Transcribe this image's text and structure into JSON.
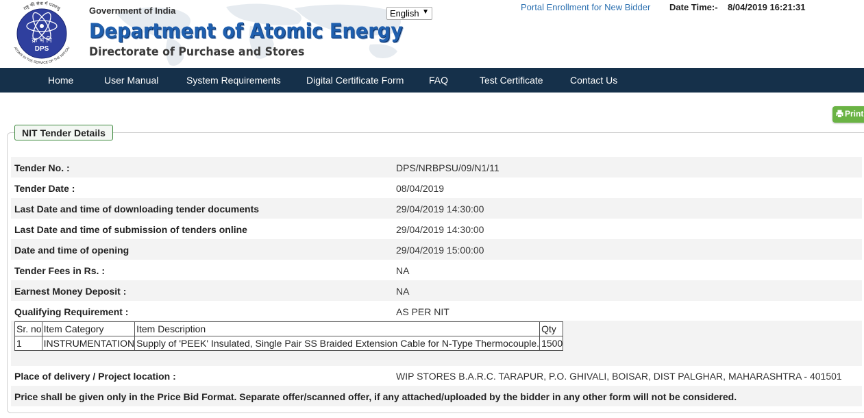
{
  "header": {
    "logo": {
      "top_arc_text": "राष्ट्र की सेवा में परमाणु",
      "center_hindi": "क्र भं नि",
      "center_text": "DPS",
      "bottom_arc_text": "ATOMS IN THE SERVICE OF THE NATION"
    },
    "government": "Government of India",
    "department": "Department of Atomic Energy",
    "directorate": "Directorate of Purchase and Stores",
    "language": "English",
    "portal_link": "Portal Enrollment for New Bidder",
    "datetime_label": "Date Time:-",
    "datetime_value": "8/04/2019 16:21:31"
  },
  "nav": {
    "items": [
      "Home",
      "User Manual",
      "System Requirements",
      "Digital Certificate Form",
      "FAQ",
      "Test Certificate",
      "Contact Us"
    ]
  },
  "print_label": "Print",
  "section_title": "NIT Tender Details",
  "details": [
    {
      "label": "Tender No. :",
      "value": "DPS/NRBPSU/09/N1/11"
    },
    {
      "label": "Tender Date :",
      "value": "08/04/2019"
    },
    {
      "label": "Last Date and time of downloading tender documents",
      "value": "29/04/2019 14:30:00"
    },
    {
      "label": "Last Date and time of submission of tenders online",
      "value": "29/04/2019 14:30:00"
    },
    {
      "label": "Date and time of opening",
      "value": "29/04/2019 15:00:00"
    },
    {
      "label": "Tender Fees in Rs. :",
      "value": "NA"
    },
    {
      "label": "Earnest Money Deposit :",
      "value": "NA"
    },
    {
      "label": "Qualifying Requirement :",
      "value": "AS PER NIT"
    }
  ],
  "items_table": {
    "headers": [
      "Sr. no",
      "Item Category",
      "Item Description",
      "Qty"
    ],
    "rows": [
      [
        "1",
        "INSTRUMENTATION",
        "Supply of 'PEEK' Insulated, Single Pair SS Braided Extension Cable for N-Type Thermocouple.",
        "1500"
      ]
    ]
  },
  "delivery": {
    "label": "Place of delivery / Project location :",
    "value": "WIP STORES B.A.R.C. TARAPUR, P.O. GHIVALI, BOISAR, DIST PALGHAR, MAHARASHTRA - 401501"
  },
  "note": "Price shall be given only in the Price Bid Format. Separate offer/scanned offer, if any attached/uploaded by the bidder in any other form will not be considered."
}
